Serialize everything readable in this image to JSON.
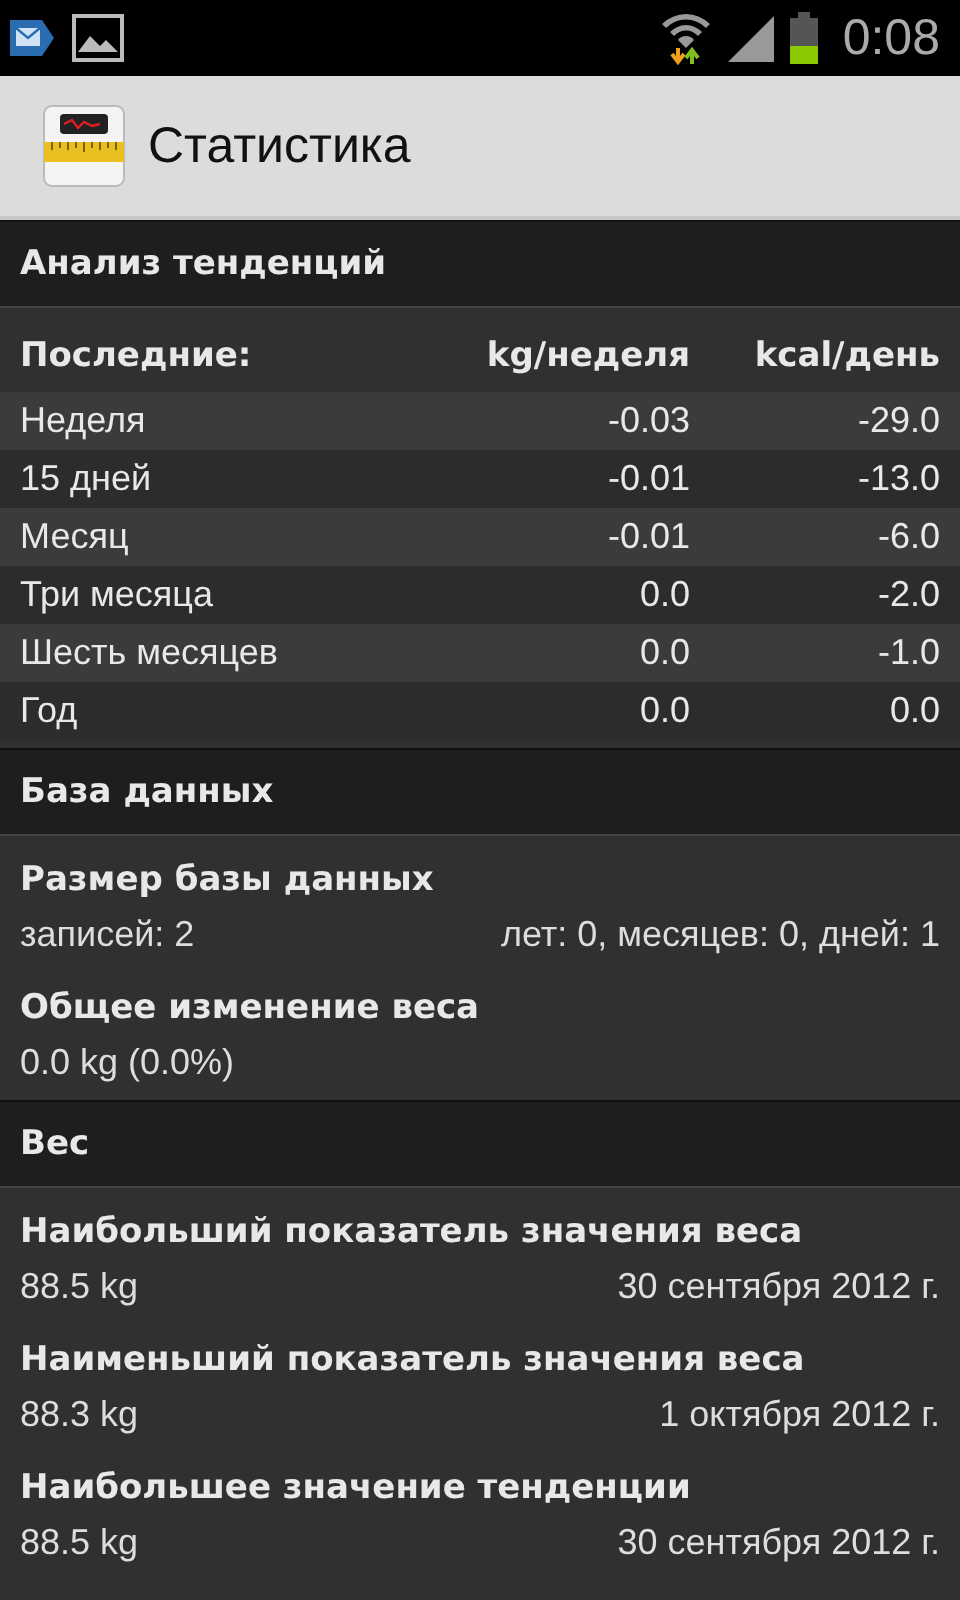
{
  "status_bar": {
    "time": "0:08"
  },
  "action_bar": {
    "title": "Статистика"
  },
  "sections": [
    {
      "kind": "table",
      "title": "Анализ тенденций",
      "columns": [
        "Последние:",
        "kg/неделя",
        "kcal/день"
      ],
      "rows": [
        [
          "Неделя",
          "-0.03",
          "-29.0"
        ],
        [
          "15 дней",
          "-0.01",
          "-13.0"
        ],
        [
          "Месяц",
          "-0.01",
          "-6.0"
        ],
        [
          "Три месяца",
          "0.0",
          "-2.0"
        ],
        [
          "Шесть месяцев",
          "0.0",
          "-1.0"
        ],
        [
          "Год",
          "0.0",
          "0.0"
        ]
      ]
    },
    {
      "kind": "stats",
      "title": "База данных",
      "items": [
        {
          "title": "Размер базы данных",
          "value": "записей: 2",
          "detail": "лет: 0, месяцев: 0, дней: 1"
        },
        {
          "title": "Общее изменение веса",
          "value": "0.0 kg (0.0%)"
        }
      ]
    },
    {
      "kind": "stats",
      "title": "Вес",
      "items": [
        {
          "title": "Наибольший показатель значения веса",
          "value": "88.5 kg",
          "detail": "30 сентября 2012 г."
        },
        {
          "title": "Наименьший показатель значения веса",
          "value": "88.3 kg",
          "detail": "1 октября 2012 г."
        },
        {
          "title": "Наибольшее значение тенденции",
          "value": "88.5 kg",
          "detail": "30 сентября 2012 г."
        }
      ]
    }
  ]
}
